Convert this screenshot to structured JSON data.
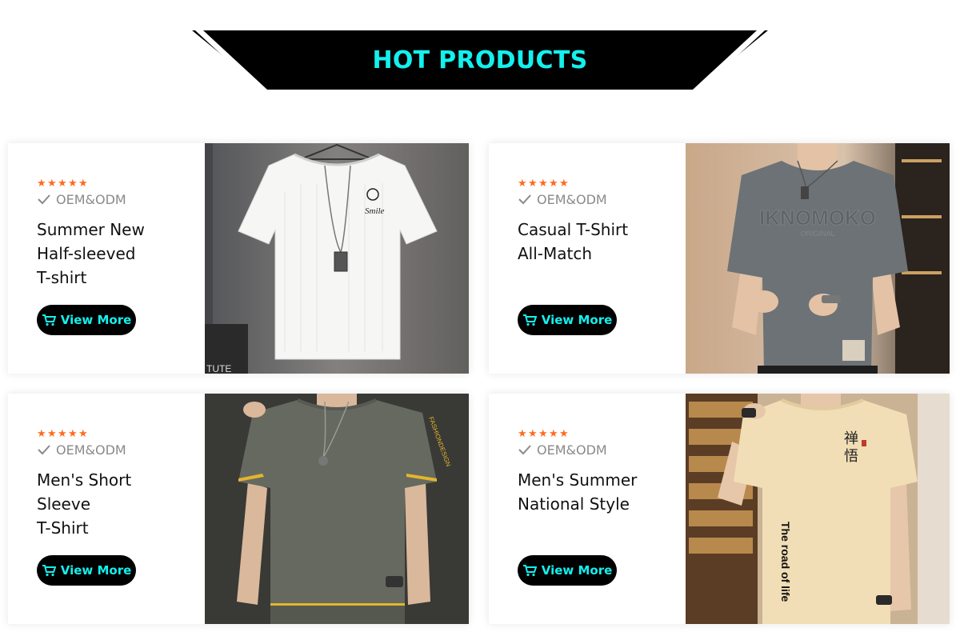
{
  "header": {
    "title": "HOT PRODUCTS",
    "title_color": "#13f0ee",
    "banner_color": "#000000"
  },
  "products": [
    {
      "rating_stars": 5,
      "badge": "OEM&ODM",
      "title": "Summer New\nHalf-sleeved\nT-shirt",
      "button_label": "View More",
      "button_icon": "cart-icon",
      "image": "white-tshirt-photo",
      "image_text": {
        "print": "Smile",
        "corner": "TUTE"
      }
    },
    {
      "rating_stars": 5,
      "badge": "OEM&ODM",
      "title": "Casual T-Shirt\nAll-Match",
      "button_label": "View More",
      "button_icon": "cart-icon",
      "image": "gray-tshirt-photo",
      "image_text": {
        "print": "IKNOMOKO",
        "sub": "ORIGINAL"
      }
    },
    {
      "rating_stars": 5,
      "badge": "OEM&ODM",
      "title": "Men's Short\nSleeve\nT-Shirt",
      "button_label": "View More",
      "button_icon": "cart-icon",
      "image": "olive-tshirt-photo",
      "image_text": {
        "sleeve": "FASHIONDESIGN"
      }
    },
    {
      "rating_stars": 5,
      "badge": "OEM&ODM",
      "title": "Men's Summer\nNational Style",
      "button_label": "View More",
      "button_icon": "cart-icon",
      "image": "beige-tshirt-photo",
      "image_text": {
        "print": "The road of life"
      }
    }
  ],
  "colors": {
    "accent": "#13f0ee",
    "star": "#ff6a1f",
    "button_bg": "#000000",
    "badge_text": "#8a8a8a"
  }
}
